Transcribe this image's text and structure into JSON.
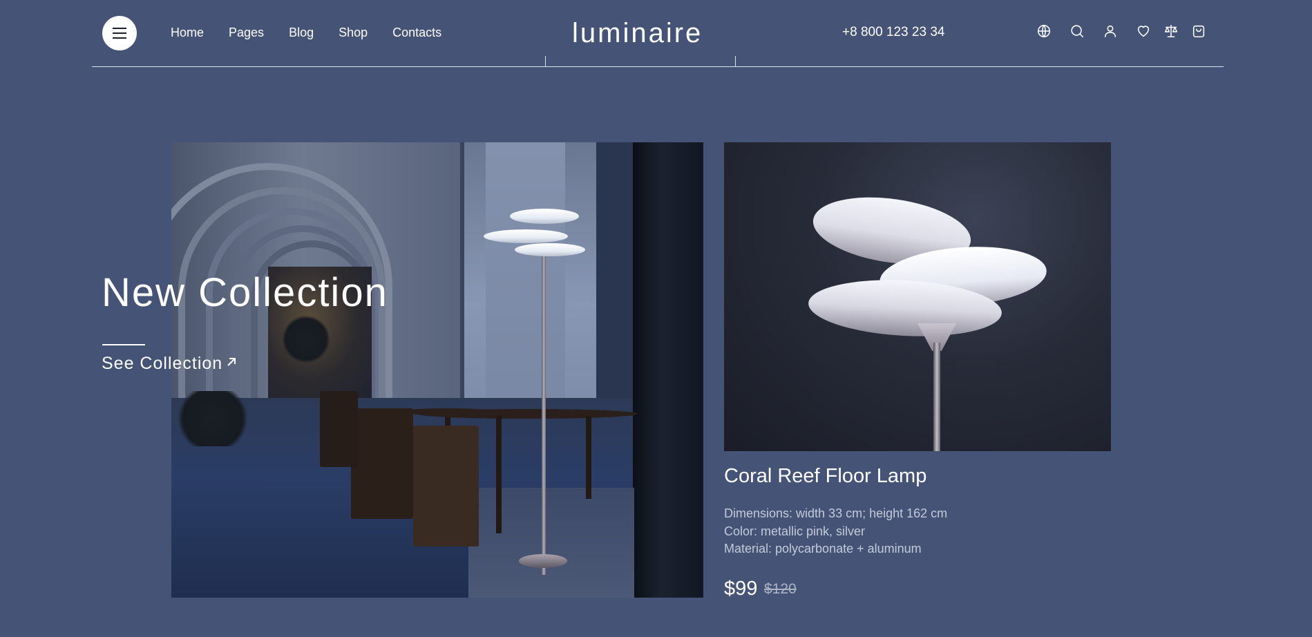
{
  "header": {
    "logo": "luminaire",
    "nav": [
      "Home",
      "Pages",
      "Blog",
      "Shop",
      "Contacts"
    ],
    "phone": "+8 800 123 23 34",
    "icons": [
      "globe-icon",
      "search-icon",
      "user-icon",
      "heart-icon",
      "scales-icon",
      "bag-icon"
    ]
  },
  "hero": {
    "title": "New Collection",
    "link_label": "See Collection"
  },
  "product": {
    "name": "Coral Reef Floor Lamp",
    "specs": [
      "Dimensions: width 33 cm; height 162 cm",
      "Color: metallic pink, silver",
      "Material: polycarbonate + aluminum"
    ],
    "price": "$99",
    "old_price": "$120"
  },
  "colors": {
    "background": "#455476",
    "text": "#ffffff",
    "muted": "#c3cad9"
  }
}
